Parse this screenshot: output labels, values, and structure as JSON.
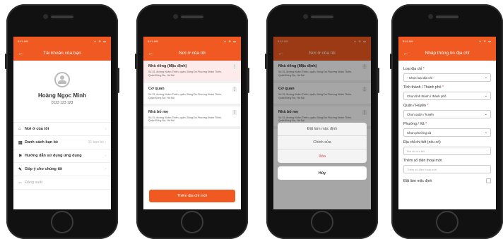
{
  "status": {
    "time": "9:41 AM",
    "icons": "▲ ≋ ▬"
  },
  "screen1": {
    "title": "Tài khoản của bạn",
    "name": "Hoàng Ngọc Minh",
    "phone": "0123 123 123",
    "menu": [
      {
        "label": "Nơi ở của tôi",
        "icon": "home-icon",
        "glyph": "⌂",
        "right": "›"
      },
      {
        "label": "Danh sách bạn bè",
        "icon": "friends-icon",
        "glyph": "▤",
        "right": "31 bạn bè ›"
      },
      {
        "label": "Hướng dẫn sử dụng ứng dụng",
        "icon": "guide-icon",
        "glyph": "⚑",
        "right": "›"
      },
      {
        "label": "Góp ý cho chúng tôi",
        "icon": "feedback-icon",
        "glyph": "✎",
        "right": "›"
      },
      {
        "label": "Đăng xuất",
        "icon": "logout-icon",
        "glyph": "⇦",
        "right": ""
      }
    ]
  },
  "screen2": {
    "title": "Nơi ở của tôi",
    "addresses": [
      {
        "name": "Nhà riêng (Mặc định)",
        "text": "Số 15, đường Khâm Thiên, quận, Đống Đa Phường Khâm Thiên, Quận Đống Đa, Hà Nội"
      },
      {
        "name": "Cơ quan",
        "text": "Số 15, đường Khâm Thiên, quận, Đống Đa Phường Khâm Thiên, Quận Đống Đa, Hà Nội"
      },
      {
        "name": "Nhà bố mẹ",
        "text": "Số 15, đường Khâm Thiên, quận, Đống Đa Phường Khâm Thiên, Quận Đống Đa, Hà Nội"
      }
    ],
    "add_button": "Thêm địa chỉ mới"
  },
  "screen3": {
    "title": "Nơi ở của tôi",
    "actions": [
      "Đặt làm mặc định",
      "Chỉnh sửa",
      "Xóa"
    ],
    "cancel": "Hủy"
  },
  "screen4": {
    "title": "Nhập thông tin địa chỉ",
    "fields": [
      {
        "label": "Loại địa chỉ",
        "required": "*",
        "kind": "select",
        "value": "- Chọn loại địa chỉ -"
      },
      {
        "label": "Tỉnh thành / Thành phố",
        "required": "*",
        "kind": "select",
        "value": "Chọn tỉnh thành / thành phố"
      },
      {
        "label": "Quận / Huyện",
        "required": "*",
        "kind": "select",
        "value": "Chọn quận / huyện"
      },
      {
        "label": "Phường / Xã",
        "required": "*",
        "kind": "select",
        "value": "Chọn phường xã"
      },
      {
        "label": "Địa chỉ chi tiết (nếu có)",
        "required": "",
        "kind": "input",
        "value": "Địa chỉ chi tiết"
      },
      {
        "label": "Thêm số điện thoại mới",
        "required": "",
        "kind": "input",
        "value": "Thêm số điện thoại mới"
      }
    ],
    "default_label": "Đặt làm mặc định"
  },
  "colors": {
    "accent": "#f05a22",
    "danger": "#e53935"
  }
}
